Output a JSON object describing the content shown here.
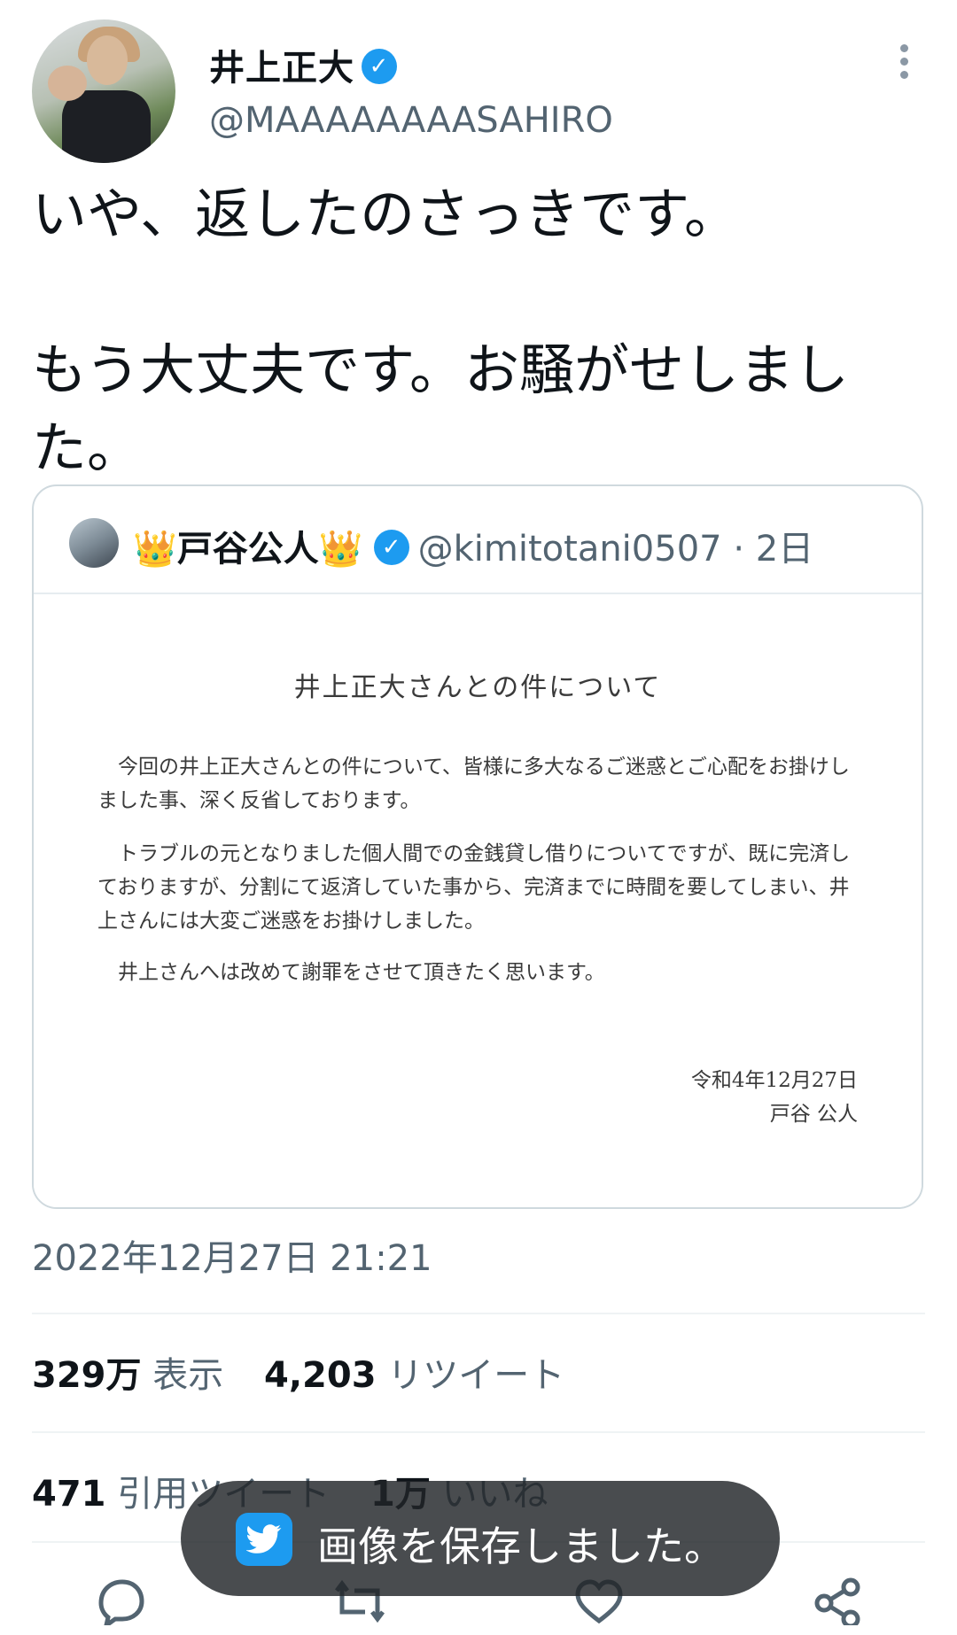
{
  "author": {
    "name": "井上正大",
    "handle": "@MAAAAAAAASAHIRO"
  },
  "tweet": {
    "text": "いや、返したのさっきです。\n\nもう大丈夫です。お騒がせしました。"
  },
  "quote": {
    "crown_left": "👑",
    "name": "戸谷公人",
    "crown_right": "👑",
    "handle": "@kimitotani0507",
    "separator": "·",
    "time": "2日",
    "document": {
      "title": "井上正大さんとの件について",
      "paragraph1": "今回の井上正大さんとの件について、皆様に多大なるご迷惑とご心配をお掛けしました事、深く反省しております。",
      "paragraph2": "トラブルの元となりました個人間での金銭貸し借りについてですが、既に完済しておりますが、分割にて返済していた事から、完済までに時間を要してしまい、井上さんには大変ご迷惑をお掛けしました。",
      "paragraph3": "井上さんへは改めて謝罪をさせて頂きたく思います。",
      "date": "令和4年12月27日",
      "signature": "戸谷 公人"
    }
  },
  "timestamp": "2022年12月27日 21:21",
  "stats": {
    "views_count": "329万",
    "views_label": "表示",
    "retweets_count": "4,203",
    "retweets_label": "リツイート",
    "quotes_count": "471",
    "quotes_label": "引用ツイート",
    "likes_count": "1万",
    "likes_label": "いいね"
  },
  "toast": {
    "text": "画像を保存しました。"
  },
  "icons": {
    "verified": "verified-badge-icon",
    "more": "more-vertical-icon",
    "reply": "reply-icon",
    "retweet": "retweet-icon",
    "like": "heart-icon",
    "share": "share-icon",
    "twitter": "twitter-bird-icon"
  },
  "colors": {
    "accent": "#1d9bf0",
    "secondary_text": "#536471",
    "toast_bg": "#212428"
  }
}
